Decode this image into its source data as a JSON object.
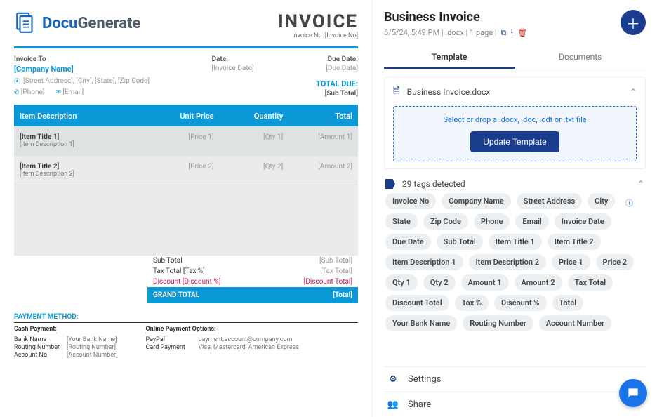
{
  "invoice": {
    "brand_left": "Docu",
    "brand_right": "Generate",
    "title": "INVOICE",
    "title_sub": "Invoice No: [Invoice No]",
    "invoice_to_label": "Invoice To",
    "company_name": "[Company Name]",
    "address": "[Street Address], [City], [State], [Zip Code]",
    "phone": "[Phone]",
    "email": "[Email]",
    "date_label": "Date:",
    "date_value": "[Invoice Date]",
    "due_label": "Due Date:",
    "due_value": "[Due Date]",
    "total_due_label": "TOTAL DUE:",
    "total_due_value": "[Sub Total]",
    "th_desc": "Item Description",
    "th_price": "Unit Price",
    "th_qty": "Quantity",
    "th_total": "Total",
    "items": [
      {
        "title": "[Item Title 1]",
        "desc": "[Item Description 1]",
        "price": "[Price 1]",
        "qty": "[Qty 1]",
        "amount": "[Amount 1]"
      },
      {
        "title": "[Item Title 2]",
        "desc": "[Item Description 2]",
        "price": "[Price 2]",
        "qty": "[Qty 2]",
        "amount": "[Amount 2]"
      }
    ],
    "subtotal_label": "Sub Total",
    "subtotal_value": "[Sub Total]",
    "tax_label": "Tax Total [Tax %]",
    "tax_value": "[Tax Total]",
    "discount_label": "Discount [Discount %]",
    "discount_value": "[Discount Total]",
    "grand_label": "GRAND TOTAL",
    "grand_value": "[Total]",
    "payment_title": "PAYMENT METHOD:",
    "cash_title": "Cash Payment:",
    "bank_name_k": "Bank Name",
    "bank_name_v": "[Your Bank Name]",
    "routing_k": "Routing Number",
    "routing_v": "[Routing Number]",
    "account_k": "Account No",
    "account_v": "[Account Number]",
    "online_title": "Online Payment Options:",
    "paypal_k": "PayPal",
    "paypal_v": "payment.account@company.com",
    "card_k": "Card Payment",
    "card_v": "Visa, Mastercard, American Express"
  },
  "panel": {
    "title": "Business Invoice",
    "meta_text": "6/5/24, 5:49 PM | .docx | 1 page |",
    "tab_template": "Template",
    "tab_documents": "Documents",
    "file_name": "Business Invoice.docx",
    "dropzone_text": "Select or drop a .docx, .doc, .odt or .txt file",
    "update_btn": "Update Template",
    "tags_detected": "29 tags detected",
    "tags": [
      "Invoice No",
      "Company Name",
      "Street Address",
      "City",
      "State",
      "Zip Code",
      "Phone",
      "Email",
      "Invoice Date",
      "Due Date",
      "Sub Total",
      "Item Title 1",
      "Item Title 2",
      "Item Description 1",
      "Item Description 2",
      "Price 1",
      "Price 2",
      "Qty 1",
      "Qty 2",
      "Amount 1",
      "Amount 2",
      "Tax Total",
      "Discount Total",
      "Tax %",
      "Discount %",
      "Total",
      "Your Bank Name",
      "Routing Number",
      "Account Number"
    ],
    "settings": "Settings",
    "share": "Share"
  }
}
